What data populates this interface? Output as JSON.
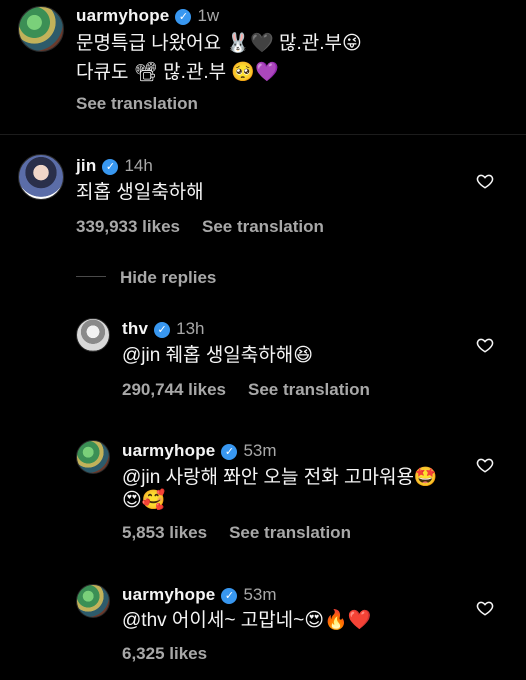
{
  "post": {
    "username": "uarmyhope",
    "time": "1w",
    "line1": "문명특급 나왔어요 🐰🖤 많.관.부😜",
    "line2": "다큐도 📽  많.관.부 🥺💜",
    "see_translation": "See translation"
  },
  "comments": [
    {
      "username": "jin",
      "time": "14h",
      "text": "죄홉 생일축하해",
      "likes": "339,933 likes",
      "see_translation": "See translation"
    }
  ],
  "hide_replies": "Hide replies",
  "replies": [
    {
      "username": "thv",
      "time": "13h",
      "text": "@jin 줴홉 생일축하해😆",
      "likes": "290,744 likes",
      "see_translation": "See translation"
    },
    {
      "username": "uarmyhope",
      "time": "53m",
      "text_line1": "@jin 사랑해 쫘안 오늘 전화 고마워용🤩",
      "text_line2": "😍🥰",
      "likes": "5,853 likes",
      "see_translation": "See translation"
    },
    {
      "username": "uarmyhope",
      "time": "53m",
      "text": "@thv 어이세~ 고맙네~😍🔥❤️",
      "likes": "6,325 likes"
    }
  ],
  "icons": {
    "verified": "verified-badge-icon",
    "heart": "heart-outline-icon"
  }
}
